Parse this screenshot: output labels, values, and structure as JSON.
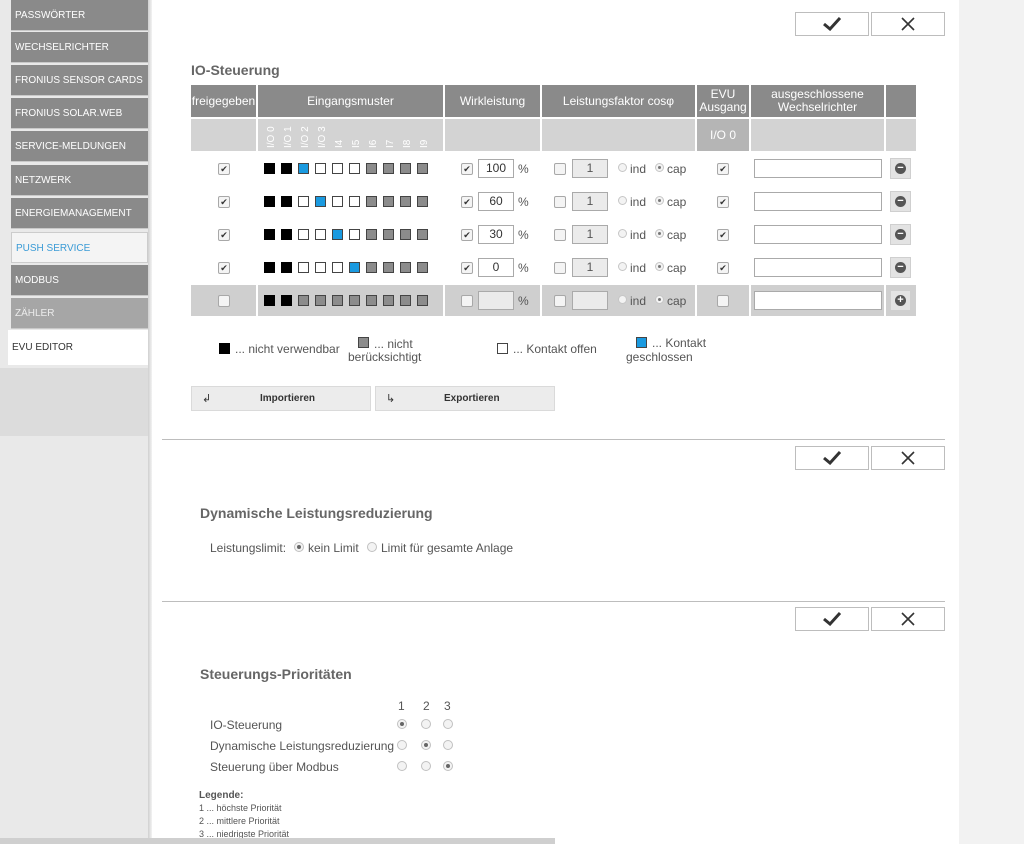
{
  "sidebar": {
    "items": [
      {
        "label": "PASSWÖRTER"
      },
      {
        "label": "WECHSELRICHTER"
      },
      {
        "label": "FRONIUS SENSOR CARDS"
      },
      {
        "label": "FRONIUS SOLAR.WEB"
      },
      {
        "label": "SERVICE-MELDUNGEN"
      },
      {
        "label": "NETZWERK"
      },
      {
        "label": "ENERGIEMANAGEMENT"
      },
      {
        "label": "PUSH SERVICE"
      },
      {
        "label": "MODBUS"
      },
      {
        "label": "ZÄHLER"
      },
      {
        "label": "EVU EDITOR"
      }
    ]
  },
  "icons": {
    "confirm": "checkmark-icon",
    "cancel": "close-icon",
    "remove": "minus-circle-icon",
    "add": "plus-circle-icon",
    "import": "import-arrow-icon",
    "export": "export-arrow-icon"
  },
  "colors": {
    "header_gray": "#8a8a8a",
    "contact_closed": "#1a9ae0",
    "accent_link": "#3a9bd6"
  },
  "io": {
    "title": "IO-Steuerung",
    "headers": {
      "enabled": "freigegeben",
      "pattern": "Eingangsmuster",
      "power": "Wirkleistung",
      "pf": "Leistungsfaktor cosφ",
      "evu_line1": "EVU",
      "evu_line2": "Ausgang",
      "excluded_line1": "ausgeschlossene",
      "excluded_line2": "Wechselrichter",
      "evu_sub": "I/O 0"
    },
    "io_labels": [
      "I/O 0",
      "I/O 1",
      "I/O 2",
      "I/O 3",
      "I4",
      "I5",
      "I6",
      "I7",
      "I8",
      "I9"
    ],
    "rows": [
      {
        "enabled": true,
        "pattern": [
          "b",
          "b",
          "u",
          "w",
          "w",
          "w",
          "g",
          "g",
          "g",
          "g"
        ],
        "power_checked": true,
        "power": "100",
        "pf_checked": false,
        "pf": "1",
        "pf_mode": "cap",
        "evu": true,
        "excluded": "",
        "action": "remove"
      },
      {
        "enabled": true,
        "pattern": [
          "b",
          "b",
          "w",
          "u",
          "w",
          "w",
          "g",
          "g",
          "g",
          "g"
        ],
        "power_checked": true,
        "power": "60",
        "pf_checked": false,
        "pf": "1",
        "pf_mode": "cap",
        "evu": true,
        "excluded": "",
        "action": "remove"
      },
      {
        "enabled": true,
        "pattern": [
          "b",
          "b",
          "w",
          "w",
          "u",
          "w",
          "g",
          "g",
          "g",
          "g"
        ],
        "power_checked": true,
        "power": "30",
        "pf_checked": false,
        "pf": "1",
        "pf_mode": "cap",
        "evu": true,
        "excluded": "",
        "action": "remove"
      },
      {
        "enabled": true,
        "pattern": [
          "b",
          "b",
          "w",
          "w",
          "w",
          "u",
          "g",
          "g",
          "g",
          "g"
        ],
        "power_checked": true,
        "power": "0",
        "pf_checked": false,
        "pf": "1",
        "pf_mode": "cap",
        "evu": true,
        "excluded": "",
        "action": "remove"
      },
      {
        "enabled": false,
        "pattern": [
          "b",
          "b",
          "g",
          "g",
          "g",
          "g",
          "g",
          "g",
          "g",
          "g"
        ],
        "power_checked": false,
        "power": "",
        "pf_checked": false,
        "pf": "",
        "pf_mode": "cap",
        "evu": false,
        "excluded": "",
        "action": "add"
      }
    ],
    "unit_percent": "%",
    "ind": "ind",
    "cap": "cap",
    "legend": {
      "unusable": "... nicht verwendbar",
      "ignored_1": "... nicht",
      "ignored_2": "berücksichtigt",
      "open": "... Kontakt offen",
      "closed_1": "... Kontakt",
      "closed_2": "geschlossen"
    },
    "import_label": "Importieren",
    "export_label": "Exportieren"
  },
  "dyn": {
    "title": "Dynamische Leistungsreduzierung",
    "label": "Leistungslimit:",
    "options": [
      "kein Limit",
      "Limit für gesamte Anlage"
    ],
    "selected": "kein Limit"
  },
  "prio": {
    "title": "Steuerungs-Prioritäten",
    "columns": [
      "1",
      "2",
      "3"
    ],
    "rows": [
      {
        "label": "IO-Steuerung",
        "selected": "1"
      },
      {
        "label": "Dynamische Leistungsreduzierung",
        "selected": "2"
      },
      {
        "label": "Steuerung über Modbus",
        "selected": "3"
      }
    ],
    "legend_title": "Legende:",
    "legend_items": [
      "1 ... höchste Priorität",
      "2 ... mittlere Priorität",
      "3 ... niedrigste Priorität"
    ]
  }
}
